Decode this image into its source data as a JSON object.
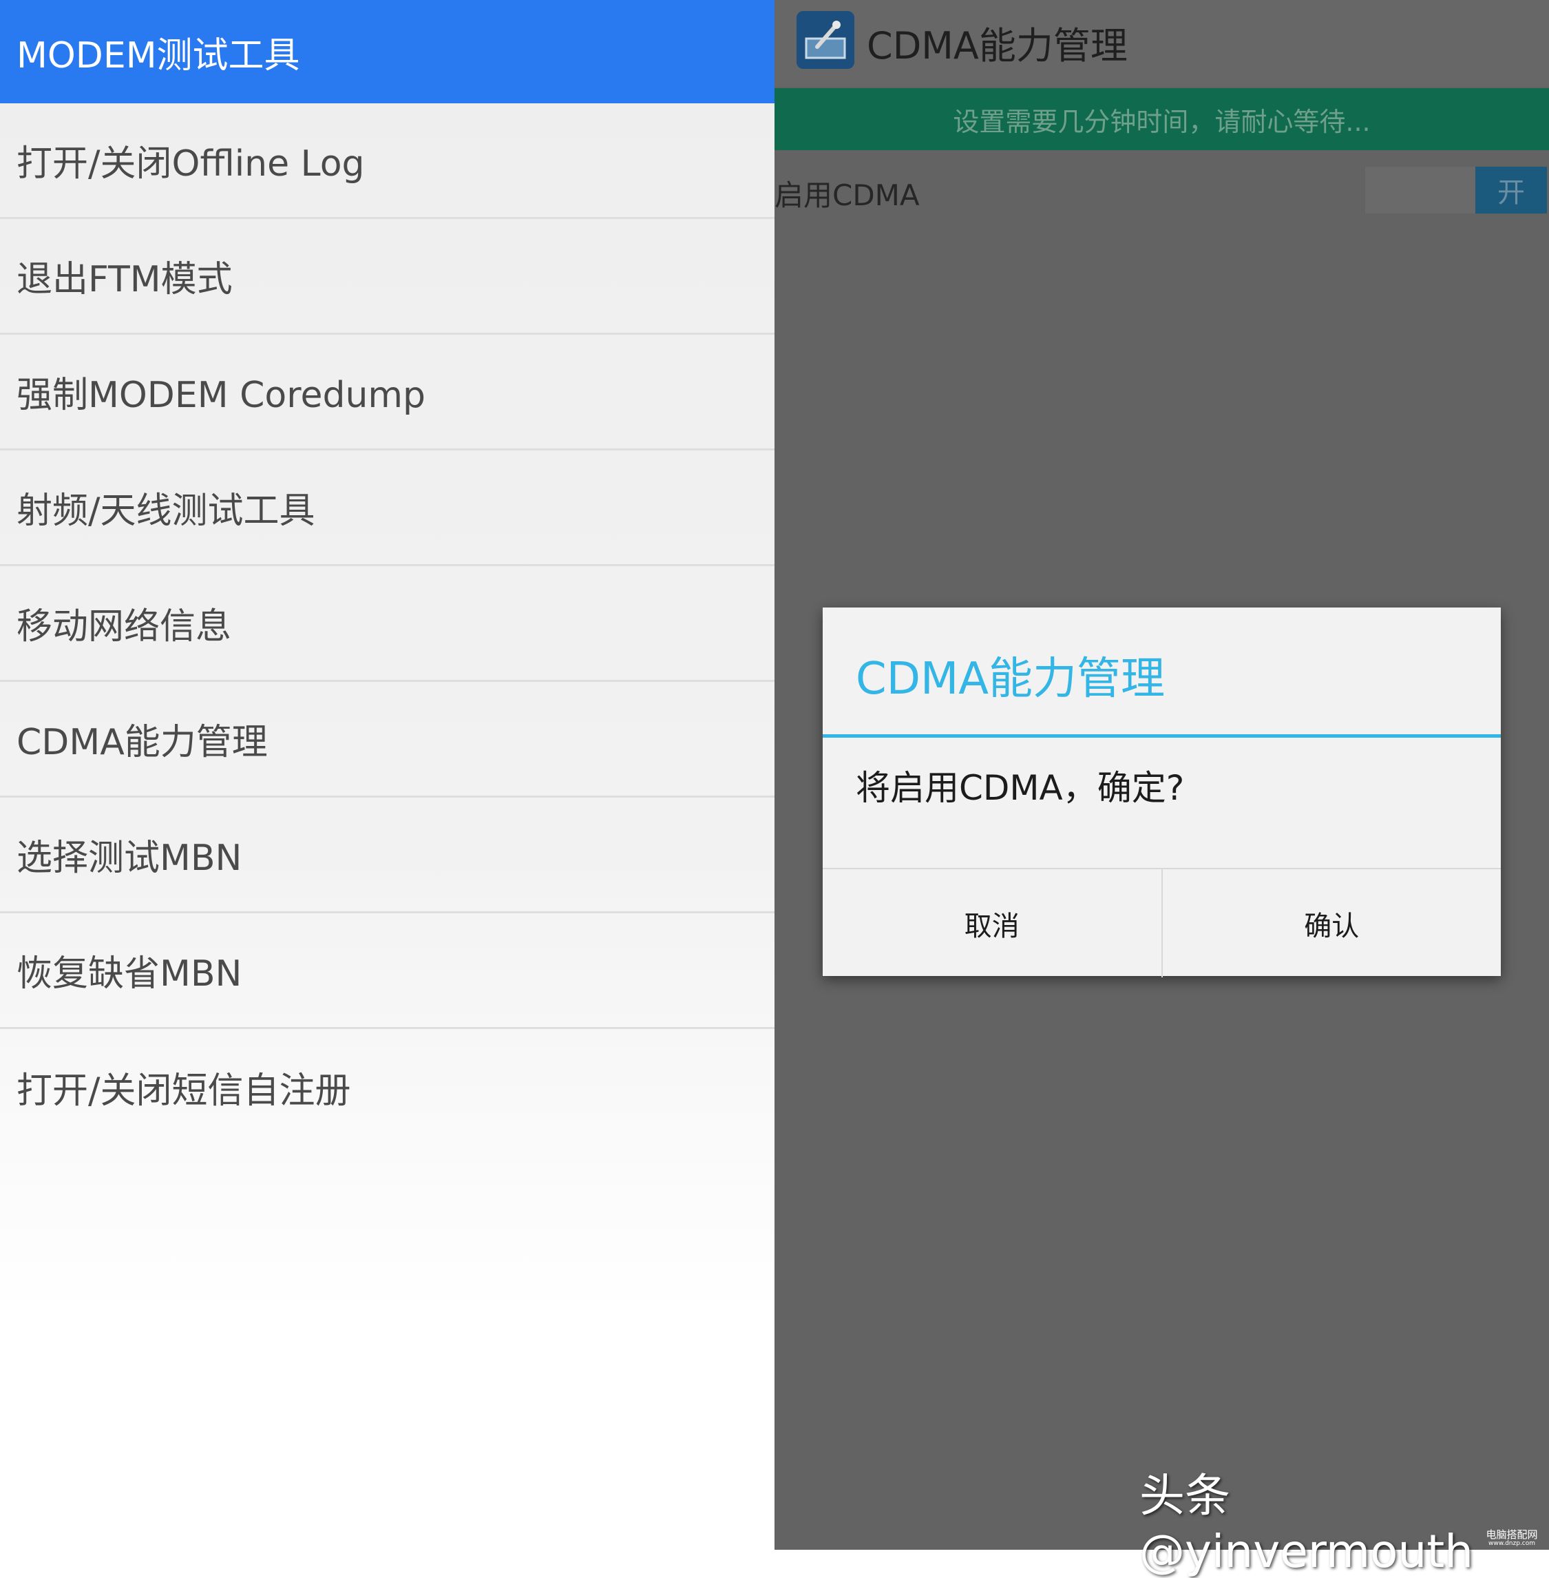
{
  "left_panel": {
    "header_title": "MODEM测试工具",
    "header_color": "#2979f0",
    "menu_items": [
      {
        "label": "打开/关闭Offline Log"
      },
      {
        "label": "退出FTM模式"
      },
      {
        "label": "强制MODEM Coredump"
      },
      {
        "label": "射频/天线测试工具"
      },
      {
        "label": "移动网络信息"
      },
      {
        "label": "CDMA能力管理"
      },
      {
        "label": "选择测试MBN"
      },
      {
        "label": "恢复缺省MBN"
      },
      {
        "label": "打开/关闭短信自注册"
      }
    ]
  },
  "right_panel": {
    "app_title": "CDMA能力管理",
    "notice": "设置需要几分钟时间，请耐心等待...",
    "enable_row": {
      "label": "启用CDMA",
      "toggle_state": "开"
    },
    "dialog": {
      "title": "CDMA能力管理",
      "message": "将启用CDMA，确定?",
      "cancel_label": "取消",
      "confirm_label": "确认",
      "accent_color": "#33b5e5"
    }
  },
  "watermark": {
    "text": "头条 @yinvermouth",
    "corner_text": "电脑搭配网",
    "corner_url": "www.dnzp.com"
  }
}
